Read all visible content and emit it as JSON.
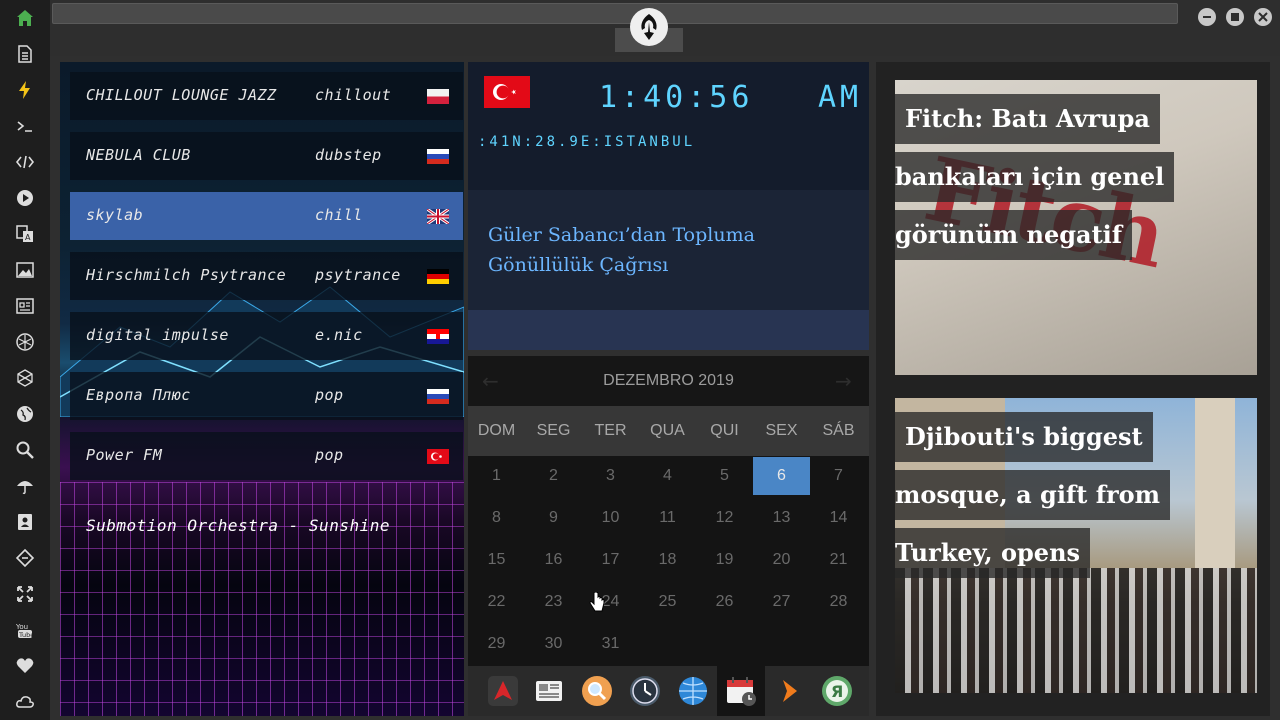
{
  "sidebar": {
    "icons": [
      "home-icon",
      "document-icon",
      "lightning-icon",
      "terminal-icon",
      "code-icon",
      "play-icon",
      "translate-icon",
      "image-icon",
      "news-icon",
      "rebel-icon",
      "hexagon-icon",
      "globe-icon",
      "search-icon",
      "umbrella-icon",
      "contact-icon",
      "tag-icon",
      "expand-icon",
      "youtube-icon",
      "heart-icon",
      "cloud-icon"
    ],
    "accent": "#4caf50"
  },
  "radio": {
    "stations": [
      {
        "name": "CHILLOUT LOUNGE JAZZ",
        "genre": "chillout",
        "flag": "poland"
      },
      {
        "name": "NEBULA CLUB",
        "genre": "dubstep",
        "flag": "russia"
      },
      {
        "name": "skylab",
        "genre": "chill",
        "flag": "uk"
      },
      {
        "name": "Hirschmilch Psytrance",
        "genre": "psytrance",
        "flag": "germany"
      },
      {
        "name": "digital impulse",
        "genre": "e.nic",
        "flag": "croatia"
      },
      {
        "name": "Европа Плюс",
        "genre": "pop",
        "flag": "russia"
      },
      {
        "name": "Power FM",
        "genre": "pop",
        "flag": "turkey"
      }
    ],
    "now_playing": "Submotion Orchestra - Sunshine"
  },
  "clock": {
    "time": "1:40:56",
    "ampm": "AM",
    "coords": ":41N:28.9E:ISTANBUL"
  },
  "news_mid": {
    "headline": "Güler Sabancı’dan Topluma Gönüllülük Çağrısı"
  },
  "calendar": {
    "title": "DEZEMBRO 2019",
    "weekdays": [
      "DOM",
      "SEG",
      "TER",
      "QUA",
      "QUI",
      "SEX",
      "SÁB"
    ],
    "days": [
      "1",
      "2",
      "3",
      "4",
      "5",
      "6",
      "7",
      "8",
      "9",
      "10",
      "11",
      "12",
      "13",
      "14",
      "15",
      "16",
      "17",
      "18",
      "19",
      "20",
      "21",
      "22",
      "23",
      "24",
      "25",
      "26",
      "27",
      "28",
      "29",
      "30",
      "31"
    ],
    "today": "6",
    "today_color": "#4a86c6"
  },
  "dock": {
    "apps": [
      "arch-icon",
      "news-app-icon",
      "search-app-icon",
      "clock-app-icon",
      "globe-app-icon",
      "calendar-app-icon",
      "arrow-app-icon",
      "yandex-icon"
    ],
    "active": "calendar-app-icon"
  },
  "news_right": [
    {
      "lines": [
        "Fitch: Batı Avrupa",
        "bankaları için genel",
        "görünüm negatif"
      ],
      "image_text": "Fitch"
    },
    {
      "lines": [
        "Djibouti's biggest",
        "mosque, a gift from",
        "Turkey, opens"
      ]
    }
  ]
}
